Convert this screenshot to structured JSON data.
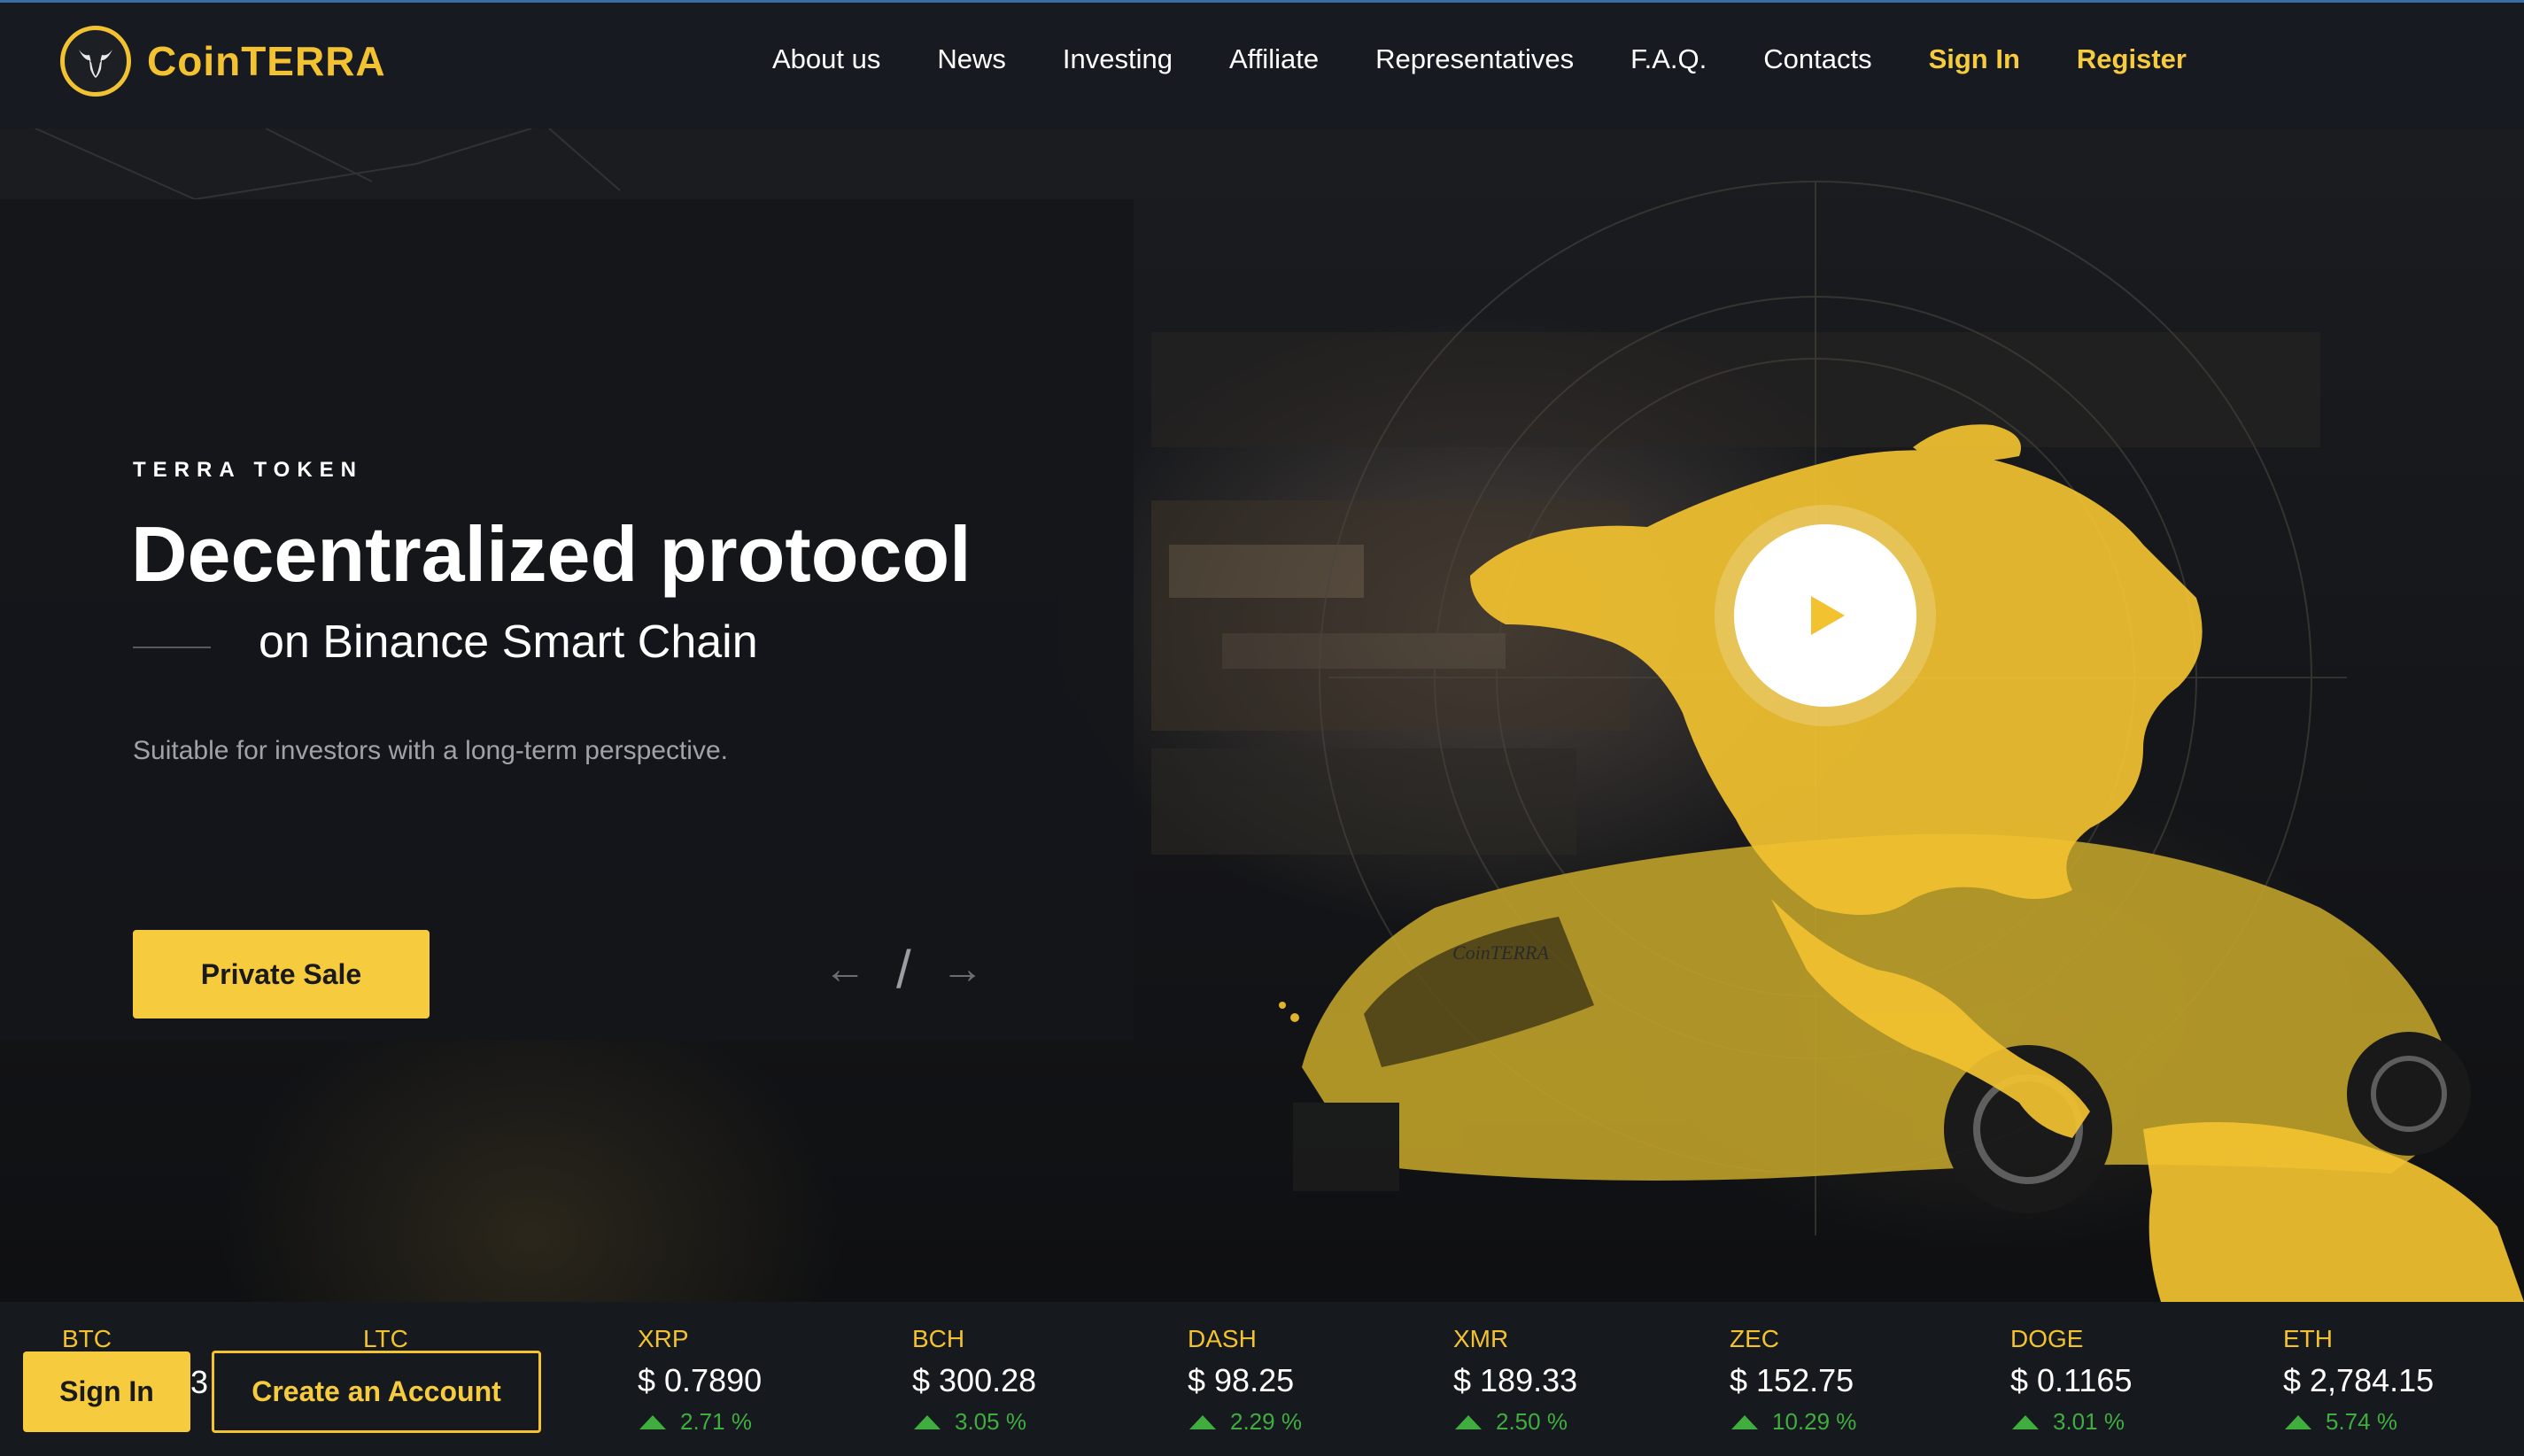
{
  "brand": {
    "name": "CoinTERRA",
    "accent": "#f6cb3d",
    "icon": "bull-head-icon"
  },
  "nav": {
    "about": "About us",
    "news": "News",
    "investing": "Investing",
    "affiliate": "Affiliate",
    "representatives": "Representatives",
    "faq": "F.A.Q.",
    "contacts": "Contacts",
    "signin": "Sign In",
    "register": "Register"
  },
  "hero": {
    "eyebrow": "TERRA TOKEN",
    "title": "Decentralized protocol",
    "subtitle": "on Binance Smart Chain",
    "description": "Suitable for investors with a long-term perspective.",
    "cta": "Private Sale",
    "slider": {
      "prev_icon": "arrow-left-icon",
      "separator": "/",
      "next_icon": "arrow-right-icon"
    },
    "play_icon": "play-icon",
    "car_logo_text": "CoinTERRA"
  },
  "ticker": [
    {
      "symbol": "BTC",
      "price": "",
      "change": ""
    },
    {
      "symbol": "LTC",
      "price": "",
      "change": ""
    },
    {
      "symbol": "XRP",
      "price": "$ 0.7890",
      "change": "2.71 %"
    },
    {
      "symbol": "BCH",
      "price": "$ 300.28",
      "change": "3.05 %"
    },
    {
      "symbol": "DASH",
      "price": "$ 98.25",
      "change": "2.29 %"
    },
    {
      "symbol": "XMR",
      "price": "$ 189.33",
      "change": "2.50 %"
    },
    {
      "symbol": "ZEC",
      "price": "$ 152.75",
      "change": "10.29 %"
    },
    {
      "symbol": "DOGE",
      "price": "$ 0.1165",
      "change": "3.01 %"
    },
    {
      "symbol": "ETH",
      "price": "$ 2,784.15",
      "change": "5.74 %"
    }
  ],
  "overlay_peek": "3",
  "bottom_bar": {
    "signin": "Sign In",
    "create": "Create an Account"
  }
}
